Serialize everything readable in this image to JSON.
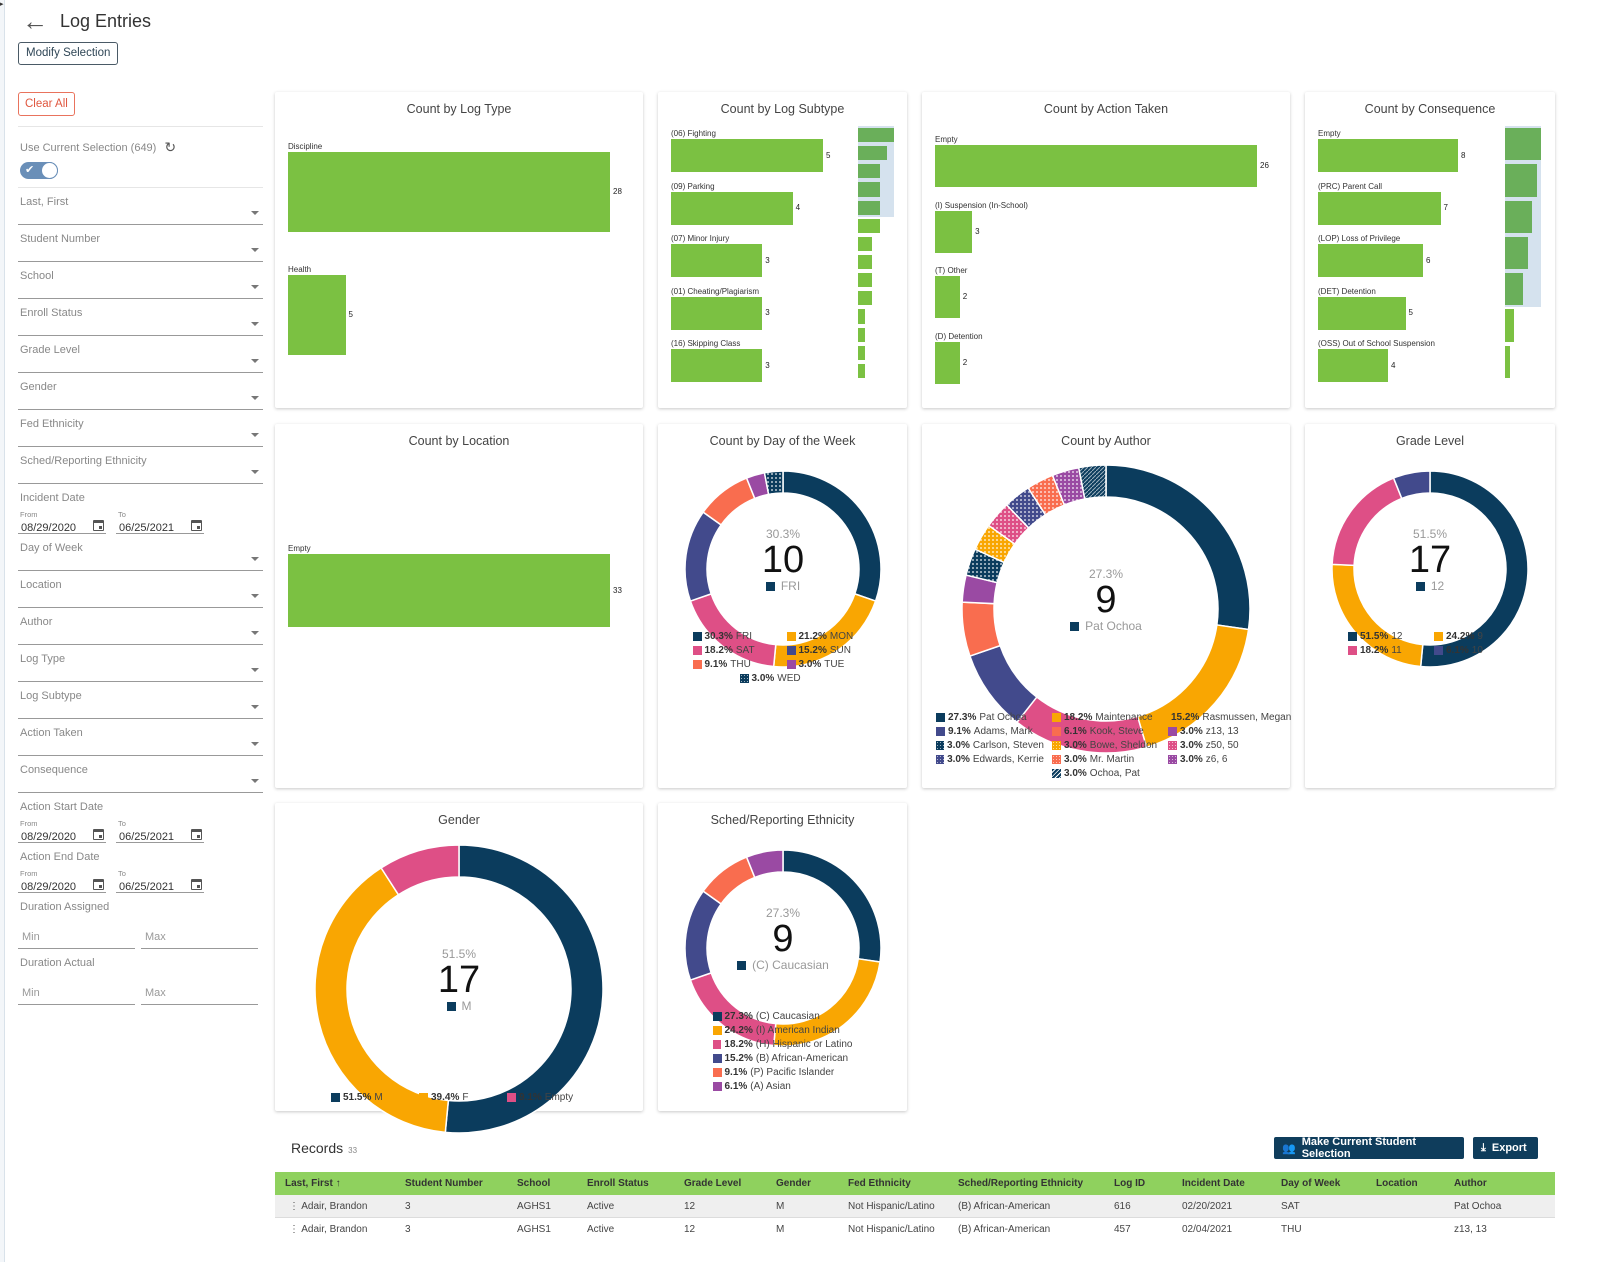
{
  "header": {
    "title": "Log Entries",
    "modify_label": "Modify Selection"
  },
  "sidebar": {
    "clear_label": "Clear All",
    "use_current_label": "Use Current Selection (649)",
    "toggle_on": true,
    "fields_a": [
      "Last, First",
      "Student Number",
      "School",
      "Enroll Status",
      "Grade Level",
      "Gender",
      "Fed Ethnicity",
      "Sched/Reporting Ethnicity"
    ],
    "incident": {
      "label": "Incident Date",
      "from_label": "From",
      "to_label": "To",
      "from": "08/29/2020",
      "to": "06/25/2021"
    },
    "fields_b": [
      "Day of Week",
      "Location",
      "Author",
      "Log Type",
      "Log Subtype",
      "Action Taken",
      "Consequence"
    ],
    "action_start": {
      "label": "Action Start Date",
      "from_label": "From",
      "to_label": "To",
      "from": "08/29/2020",
      "to": "06/25/2021"
    },
    "action_end": {
      "label": "Action End Date",
      "from_label": "From",
      "to_label": "To",
      "from": "08/29/2020",
      "to": "06/25/2021"
    },
    "duration_assigned": {
      "label": "Duration Assigned",
      "min": "Min",
      "max": "Max"
    },
    "duration_actual": {
      "label": "Duration Actual",
      "min": "Min",
      "max": "Max"
    }
  },
  "colors": {
    "bar": "#7bc142",
    "navy": "#0b3c5d",
    "orange": "#f9a602",
    "pink": "#de4f86",
    "indigo": "#424a8c",
    "coral": "#f96d4f",
    "purple": "#9a4aa3",
    "button": "#0f3d5c",
    "table_header": "#8fd15e"
  },
  "chart_data": [
    {
      "id": "log_type",
      "type": "bar",
      "title": "Count by Log Type",
      "categories": [
        "Discipline",
        "Health"
      ],
      "values": [
        28,
        5
      ],
      "orientation": "horizontal"
    },
    {
      "id": "log_subtype",
      "type": "bar",
      "title": "Count by Log Subtype",
      "categories": [
        "(06) Fighting",
        "(09) Parking",
        "(07) Minor Injury",
        "(01) Cheating/Plagiarism",
        "(16) Skipping Class"
      ],
      "values": [
        5,
        4,
        3,
        3,
        3
      ],
      "orientation": "horizontal",
      "overview_values": [
        5,
        4,
        3,
        3,
        3,
        3,
        2,
        2,
        2,
        2,
        1,
        1,
        1,
        1
      ]
    },
    {
      "id": "action_taken",
      "type": "bar",
      "title": "Count by Action Taken",
      "categories": [
        "Empty",
        "(I) Suspension (In-School)",
        "(T) Other",
        "(D) Detention"
      ],
      "values": [
        26,
        3,
        2,
        2
      ],
      "orientation": "horizontal"
    },
    {
      "id": "consequence",
      "type": "bar",
      "title": "Count by Consequence",
      "categories": [
        "Empty",
        "(PRC) Parent Call",
        "(LOP) Loss of Privilege",
        "(DET) Detention",
        "(OSS) Out of School Suspension"
      ],
      "values": [
        8,
        7,
        6,
        5,
        4
      ],
      "orientation": "horizontal",
      "overview_values": [
        8,
        7,
        6,
        5,
        4,
        2,
        1
      ]
    },
    {
      "id": "location",
      "type": "bar",
      "title": "Count by Location",
      "categories": [
        "Empty"
      ],
      "values": [
        33
      ],
      "orientation": "horizontal"
    },
    {
      "id": "day_of_week",
      "type": "pie",
      "title": "Count by Day of the Week",
      "center": {
        "pct": "30.3%",
        "count": "10",
        "label": "FRI"
      },
      "slices": [
        {
          "label": "FRI",
          "pct": "30.3%",
          "value": 10,
          "color": "#0b3c5d"
        },
        {
          "label": "MON",
          "pct": "21.2%",
          "value": 7,
          "color": "#f9a602"
        },
        {
          "label": "SAT",
          "pct": "18.2%",
          "value": 6,
          "color": "#de4f86"
        },
        {
          "label": "SUN",
          "pct": "15.2%",
          "value": 5,
          "color": "#424a8c"
        },
        {
          "label": "THU",
          "pct": "9.1%",
          "value": 3,
          "color": "#f96d4f"
        },
        {
          "label": "TUE",
          "pct": "3.0%",
          "value": 1,
          "color": "#9a4aa3"
        },
        {
          "label": "WED",
          "pct": "3.0%",
          "value": 1,
          "color": "#0b3c5d",
          "pattern": "dots"
        }
      ]
    },
    {
      "id": "author",
      "type": "pie",
      "title": "Count by Author",
      "center": {
        "pct": "27.3%",
        "count": "9",
        "label": "Pat Ochoa"
      },
      "slices": [
        {
          "label": "Pat Ochoa",
          "pct": "27.3%",
          "value": 9,
          "color": "#0b3c5d"
        },
        {
          "label": "Maintenance",
          "pct": "18.2%",
          "value": 6,
          "color": "#f9a602"
        },
        {
          "label": "Rasmussen, Megan",
          "pct": "15.2%",
          "value": 5,
          "color": "#de4f86"
        },
        {
          "label": "Adams, Mark",
          "pct": "9.1%",
          "value": 3,
          "color": "#424a8c"
        },
        {
          "label": "Kook, Steve",
          "pct": "6.1%",
          "value": 2,
          "color": "#f96d4f"
        },
        {
          "label": "z13, 13",
          "pct": "3.0%",
          "value": 1,
          "color": "#9a4aa3"
        },
        {
          "label": "Carlson, Steven",
          "pct": "3.0%",
          "value": 1,
          "color": "#0b3c5d",
          "pattern": "dots"
        },
        {
          "label": "Bowe, Sheldon",
          "pct": "3.0%",
          "value": 1,
          "color": "#f9a602",
          "pattern": "dots"
        },
        {
          "label": "z50, 50",
          "pct": "3.0%",
          "value": 1,
          "color": "#de4f86",
          "pattern": "dots"
        },
        {
          "label": "Edwards, Kerrie",
          "pct": "3.0%",
          "value": 1,
          "color": "#424a8c",
          "pattern": "dots"
        },
        {
          "label": "Mr. Martin",
          "pct": "3.0%",
          "value": 1,
          "color": "#f96d4f",
          "pattern": "dots"
        },
        {
          "label": "z6, 6",
          "pct": "3.0%",
          "value": 1,
          "color": "#9a4aa3",
          "pattern": "dots"
        },
        {
          "label": "Ochoa, Pat",
          "pct": "3.0%",
          "value": 1,
          "color": "#0b3c5d",
          "pattern": "stripes"
        }
      ]
    },
    {
      "id": "grade_level",
      "type": "pie",
      "title": "Grade Level",
      "center": {
        "pct": "51.5%",
        "count": "17",
        "label": "12"
      },
      "slices": [
        {
          "label": "12",
          "pct": "51.5%",
          "value": 17,
          "color": "#0b3c5d"
        },
        {
          "label": "9",
          "pct": "24.2%",
          "value": 8,
          "color": "#f9a602"
        },
        {
          "label": "11",
          "pct": "18.2%",
          "value": 6,
          "color": "#de4f86"
        },
        {
          "label": "10",
          "pct": "6.1%",
          "value": 2,
          "color": "#424a8c"
        }
      ]
    },
    {
      "id": "gender",
      "type": "pie",
      "title": "Gender",
      "center": {
        "pct": "51.5%",
        "count": "17",
        "label": "M"
      },
      "slices": [
        {
          "label": "M",
          "pct": "51.5%",
          "value": 17,
          "color": "#0b3c5d"
        },
        {
          "label": "F",
          "pct": "39.4%",
          "value": 13,
          "color": "#f9a602"
        },
        {
          "label": "Empty",
          "pct": "9.1%",
          "value": 3,
          "color": "#de4f86"
        }
      ]
    },
    {
      "id": "ethnicity",
      "type": "pie",
      "title": "Sched/Reporting Ethnicity",
      "center": {
        "pct": "27.3%",
        "count": "9",
        "label": "(C) Caucasian"
      },
      "slices": [
        {
          "label": "(C) Caucasian",
          "pct": "27.3%",
          "value": 9,
          "color": "#0b3c5d"
        },
        {
          "label": "(I) American Indian",
          "pct": "24.2%",
          "value": 8,
          "color": "#f9a602"
        },
        {
          "label": "(H) Hispanic or Latino",
          "pct": "18.2%",
          "value": 6,
          "color": "#de4f86"
        },
        {
          "label": "(B) African-American",
          "pct": "15.2%",
          "value": 5,
          "color": "#424a8c"
        },
        {
          "label": "(P) Pacific Islander",
          "pct": "9.1%",
          "value": 3,
          "color": "#f96d4f"
        },
        {
          "label": "(A) Asian",
          "pct": "6.1%",
          "value": 2,
          "color": "#9a4aa3"
        }
      ]
    }
  ],
  "records": {
    "title": "Records",
    "count": "33",
    "make_selection_label": "Make Current Student Selection",
    "export_label": "Export",
    "columns": [
      "Last, First",
      "Student Number",
      "School",
      "Enroll Status",
      "Grade Level",
      "Gender",
      "Fed Ethnicity",
      "Sched/Reporting Ethnicity",
      "Log ID",
      "Incident Date",
      "Day of Week",
      "Location",
      "Author"
    ],
    "sort_indicator": "↑",
    "rows": [
      [
        "Adair, Brandon",
        "3",
        "AGHS1",
        "Active",
        "12",
        "M",
        "Not Hispanic/Latino",
        "(B) African-American",
        "616",
        "02/20/2021",
        "SAT",
        "",
        "Pat Ochoa"
      ],
      [
        "Adair, Brandon",
        "3",
        "AGHS1",
        "Active",
        "12",
        "M",
        "Not Hispanic/Latino",
        "(B) African-American",
        "457",
        "02/04/2021",
        "THU",
        "",
        "z13, 13"
      ]
    ]
  }
}
